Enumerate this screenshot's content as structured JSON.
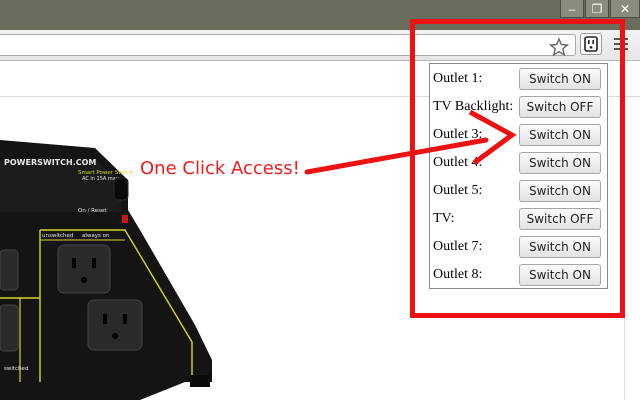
{
  "window": {
    "minimize_glyph": "–",
    "restore_glyph": "❐",
    "close_glyph": "✕"
  },
  "toolbar": {
    "star_icon": "star-icon",
    "extension_icon": "outlet-icon",
    "menu_icon": "hamburger-menu-icon"
  },
  "callout": {
    "text": "One Click Access!",
    "color": "#ee1c1c"
  },
  "popup": {
    "rows": [
      {
        "label": "Outlet 1:",
        "button": "Switch ON"
      },
      {
        "label": "TV Backlight:",
        "button": "Switch OFF"
      },
      {
        "label": "Outlet 3:",
        "button": "Switch ON"
      },
      {
        "label": "Outlet 4:",
        "button": "Switch ON"
      },
      {
        "label": "Outlet 5:",
        "button": "Switch ON"
      },
      {
        "label": "TV:",
        "button": "Switch OFF"
      },
      {
        "label": "Outlet 7:",
        "button": "Switch ON"
      },
      {
        "label": "Outlet 8:",
        "button": "Switch ON"
      }
    ]
  },
  "product": {
    "brand": "POWERSWITCH.COM",
    "badge": "Smart Power Switch",
    "ac_rating": "AC in 15A max",
    "reset_label": "On / Reset",
    "unswitched_label": "unswitched",
    "always_on_label": "always on",
    "switched_label": "switched"
  },
  "colors": {
    "highlight": "#ee1111",
    "titlebar": "#6a6d5c",
    "device": "#141414",
    "device_trim": "#d6d62a"
  }
}
